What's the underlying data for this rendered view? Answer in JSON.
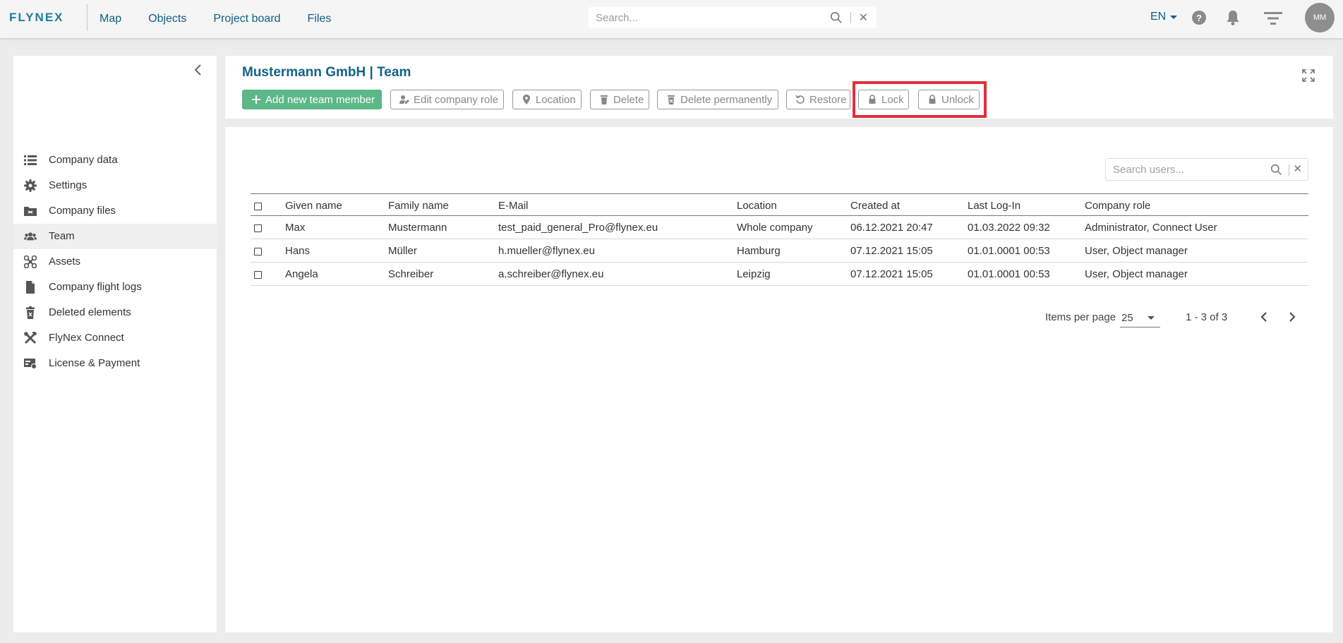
{
  "brand": {
    "logo_text": "FLYNEX",
    "color": "#1b7fa6"
  },
  "nav": {
    "items": [
      "Map",
      "Objects",
      "Project board",
      "Files"
    ]
  },
  "top_search": {
    "placeholder": "Search...",
    "value": ""
  },
  "top_right": {
    "language": "EN",
    "help_label": "?",
    "avatar_initials": "MM"
  },
  "sidebar": {
    "items": [
      {
        "label": "Company data",
        "icon": "list-icon"
      },
      {
        "label": "Settings",
        "icon": "gear-icon"
      },
      {
        "label": "Company files",
        "icon": "folder-icon"
      },
      {
        "label": "Team",
        "icon": "team-icon",
        "active": true
      },
      {
        "label": "Assets",
        "icon": "drone-icon"
      },
      {
        "label": "Company flight logs",
        "icon": "file-icon"
      },
      {
        "label": "Deleted elements",
        "icon": "trash-icon"
      },
      {
        "label": "FlyNex Connect",
        "icon": "tools-icon"
      },
      {
        "label": "License & Payment",
        "icon": "payment-icon"
      }
    ]
  },
  "header": {
    "title": "Mustermann GmbH | Team",
    "toolbar": {
      "add": "Add new team member",
      "edit_role": "Edit company role",
      "location": "Location",
      "delete": "Delete",
      "delete_permanently": "Delete permanently",
      "restore": "Restore",
      "lock": "Lock",
      "unlock": "Unlock"
    },
    "primary_color": "#5cb887",
    "highlight_color": "#e0303a"
  },
  "users": {
    "search_placeholder": "Search users...",
    "columns": [
      "Given name",
      "Family name",
      "E-Mail",
      "Location",
      "Created at",
      "Last Log-In",
      "Company role"
    ],
    "rows": [
      [
        "Max",
        "Mustermann",
        "test_paid_general_Pro@flynex.eu",
        "Whole company",
        "06.12.2021 20:47",
        "01.03.2022 09:32",
        "Administrator, Connect User"
      ],
      [
        "Hans",
        "Müller",
        "h.mueller@flynex.eu",
        "Hamburg",
        "07.12.2021 15:05",
        "01.01.0001 00:53",
        "User, Object manager"
      ],
      [
        "Angela",
        "Schreiber",
        "a.schreiber@flynex.eu",
        "Leipzig",
        "07.12.2021 15:05",
        "01.01.0001 00:53",
        "User, Object manager"
      ]
    ]
  },
  "pagination": {
    "items_per_page_label": "Items per page",
    "items_per_page": "25",
    "range": "1 - 3 of 3"
  }
}
